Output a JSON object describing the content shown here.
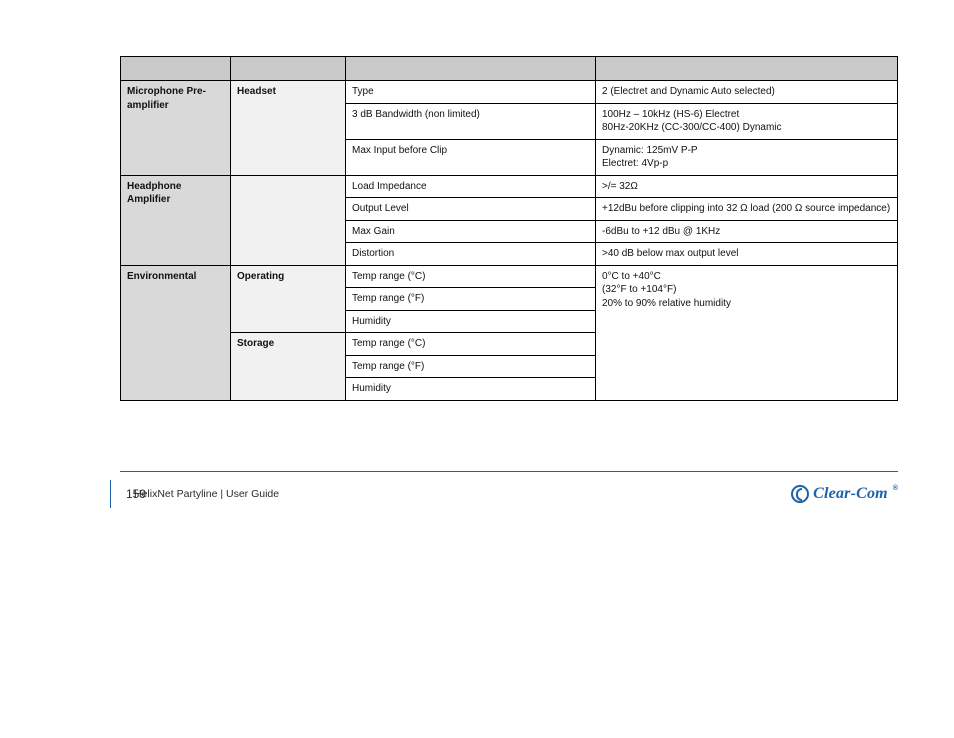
{
  "table": {
    "headers": [
      "",
      "",
      "",
      ""
    ],
    "groups": [
      {
        "category": "Microphone Pre-amplifier",
        "subgroups": [
          {
            "label": "Headset",
            "rows": [
              {
                "item": "Type",
                "value": "2 (Electret and Dynamic Auto selected)"
              },
              {
                "item": "3 dB Bandwidth (non limited)",
                "value": "100Hz – 10kHz (HS-6) Electret\n80Hz-20KHz (CC-300/CC-400) Dynamic"
              },
              {
                "item": "Max Input before Clip",
                "value": "Dynamic: 125mV P-P\nElectret: 4Vp-p"
              }
            ]
          }
        ]
      },
      {
        "category": "Headphone Amplifier",
        "subgroups": [
          {
            "label": "",
            "rows": [
              {
                "item": "Load Impedance",
                "value": ">/= 32Ω"
              },
              {
                "item": "Output Level",
                "value": "+12dBu before clipping into 32 Ω load (200 Ω source impedance)"
              },
              {
                "item": "Max Gain",
                "value": "-6dBu to +12 dBu @ 1KHz"
              },
              {
                "item": "Distortion",
                "value": ">40 dB below max output level"
              }
            ]
          }
        ]
      },
      {
        "category": "Environmental",
        "subgroups": [
          {
            "label": "Operating",
            "value_note": "0°C to +40°C\n(32°F to +104°F)\n20% to 90% relative humidity",
            "rows": [
              {
                "item": "Temp range (°C)",
                "value": ""
              },
              {
                "item": "Temp range (°F)",
                "value": ""
              },
              {
                "item": "Humidity",
                "value": ""
              }
            ]
          },
          {
            "label": "Storage",
            "rows": [
              {
                "item": "Temp range (°C)",
                "value": ""
              },
              {
                "item": "Temp range (°F)",
                "value": ""
              },
              {
                "item": "Humidity",
                "value": ""
              }
            ]
          }
        ]
      }
    ]
  },
  "footer": {
    "page": "159",
    "doc": "HelixNet Partyline | User Guide",
    "logo_text": "Clear-Com"
  }
}
